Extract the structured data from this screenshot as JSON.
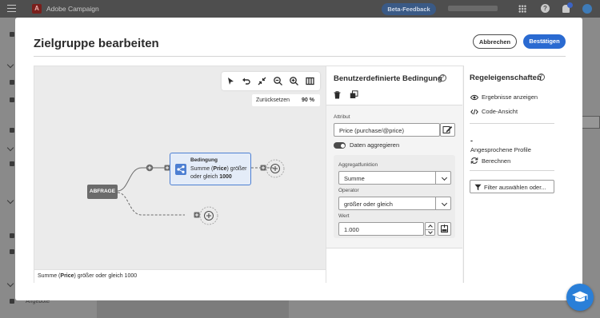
{
  "app": {
    "name": "Adobe Campaign",
    "logo_letter": "A",
    "beta_feedback": "Beta-Feedback",
    "help_glyph": "?"
  },
  "background": {
    "sidebar_item": "Angebote"
  },
  "modal": {
    "title": "Zielgruppe bearbeiten",
    "cancel_label": "Abbrechen",
    "confirm_label": "Bestätigen"
  },
  "canvas": {
    "toolbar_icons": [
      "select-arrow-icon",
      "undo-icon",
      "collapse-icon",
      "zoom-out-icon",
      "zoom-in-icon",
      "columns-icon"
    ],
    "zoom_reset_label": "Zurücksetzen",
    "zoom_value": "90 %",
    "start_node_label": "ABFRAGE",
    "condition_node": {
      "title": "Bedingung",
      "text_prefix": "Summe (",
      "text_bold1": "Price",
      "text_mid": ") größer oder gleich ",
      "text_bold2": "1000"
    },
    "footer": {
      "prefix": "Summe (",
      "bold": "Price",
      "suffix": ") größer oder gleich 1000"
    },
    "colors": {
      "condition_border": "#4d7fd2",
      "condition_fill": "#e4ecf8"
    }
  },
  "condition_panel": {
    "title": "Benutzerdefinierte Bedingung",
    "info_glyph": "?",
    "attribute_label": "Attribut",
    "attribute_value": "Price (purchase/@price)",
    "aggregate_toggle_label": "Daten aggregieren",
    "aggregate_toggle_on": true,
    "aggregate_function_label": "Aggregatfunktion",
    "aggregate_function_value": "Summe",
    "operator_label": "Operator",
    "operator_value": "größer oder gleich",
    "value_label": "Wert",
    "value": "1.000"
  },
  "rule_panel": {
    "title": "Regeleigenschaften",
    "info_glyph": "?",
    "show_results": "Ergebnisse anzeigen",
    "code_view": "Code-Ansicht",
    "count_value": "-",
    "targeted_profiles_label": "Angesprochene Profile",
    "calculate": "Berechnen",
    "filter_button": "Filter auswählen oder..."
  },
  "accent_color": "#2a6ad1"
}
